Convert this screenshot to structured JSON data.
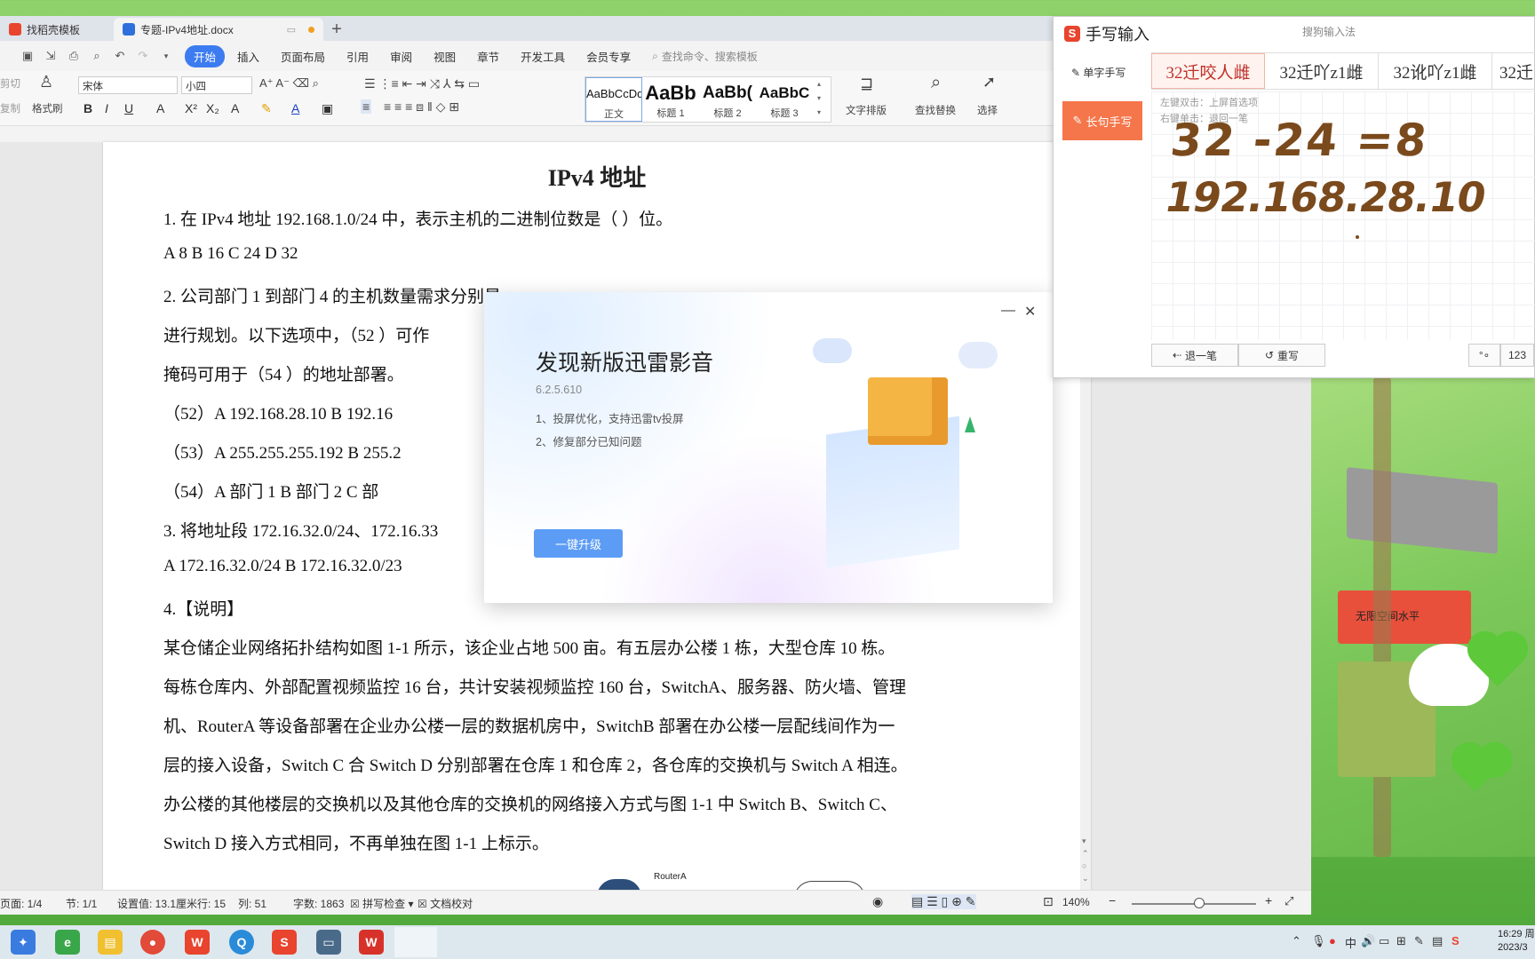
{
  "tabs": [
    {
      "label": "找稻壳模板",
      "icon": "wps-logo-icon"
    },
    {
      "label": "专题-IPv4地址.docx",
      "icon": "word-doc-icon"
    }
  ],
  "menu": [
    "开始",
    "插入",
    "页面布局",
    "引用",
    "审阅",
    "视图",
    "章节",
    "开发工具",
    "会员专享"
  ],
  "search_placeholder": "查找命令、搜索模板",
  "ribbon": {
    "cut": "剪切",
    "copy": "复制",
    "format_painter": "格式刷",
    "font_name": "宋体",
    "font_size": "小四",
    "styles": [
      {
        "sample": "AaBbCcDd",
        "label": "正文"
      },
      {
        "sample": "AaBb",
        "label": "标题 1"
      },
      {
        "sample": "AaBb(",
        "label": "标题 2"
      },
      {
        "sample": "AaBbC",
        "label": "标题 3"
      }
    ],
    "text_layout": "文字排版",
    "find_replace": "查找替换",
    "select": "选择"
  },
  "document": {
    "title": "IPv4 地址",
    "lines": [
      "1.  在 IPv4 地址 192.168.1.0/24 中，表示主机的二进制位数是（  ）位。",
      "A    8     B    16   C    24   D    32",
      "2.  公司部门 1 到部门 4 的主机数量需求分别是",
      "进行规划。以下选项中，（52  ）可作",
      "掩码可用于（54  ）的地址部署。",
      "（52）A    192.168.28.10      B    192.16",
      "（53）A    255.255.255.192   B    255.2",
      "（54）A    部门 1     B    部门 2   C    部",
      "3.  将地址段 172.16.32.0/24、172.16.33",
      "A    172.16.32.0/24    B    172.16.32.0/23",
      "4.【说明】",
      "某仓储企业网络拓扑结构如图 1-1 所示，该企业占地 500 亩。有五层办公楼 1 栋，大型仓库 10 栋。",
      "每栋仓库内、外部配置视频监控 16 台，共计安装视频监控 160 台，SwitchA、服务器、防火墙、管理",
      "机、RouterA 等设备部署在企业办公楼一层的数据机房中，SwitchB 部署在办公楼一层配线间作为一",
      "层的接入设备，Switch C 合 Switch D 分别部署在仓库 1 和仓库 2，各仓库的交换机与 Switch A 相连。",
      "办公楼的其他楼层的交换机以及其他仓库的交换机的网络接入方式与图 1-1 中 Switch B、Switch C、",
      "Switch D 接入方式相同，不再单独在图 1-1 上标示。"
    ],
    "figure_label": "RouterA"
  },
  "status": {
    "page": "页面: 1/4",
    "section": "节: 1/1",
    "setting": "设置值: 13.1厘米",
    "row": "行: 15",
    "col": "列: 51",
    "words": "字数: 1863",
    "spell": "拼写检查",
    "proof": "文档校对",
    "zoom": "140%"
  },
  "popup": {
    "title": "发现新版迅雷影音",
    "version": "6.2.5.610",
    "notes": [
      "1、投屏优化，支持迅雷tv投屏",
      "2、修复部分已知问题"
    ],
    "button": "一键升级"
  },
  "ime": {
    "title": "手写输入",
    "subtitle": "搜狗输入法",
    "single": "单字手写",
    "long": "长句手写",
    "candidates": [
      "32迁咬人雌",
      "32迁吖z1雌",
      "32讹吖z1雌",
      "32迁"
    ],
    "hint1": "左键双击：上屏首选项",
    "hint2": "右键单击：退回一笔",
    "handwriting_line1": "32 -24 =8",
    "handwriting_line2": "192.168.28.10",
    "undo": "退一笔",
    "rewrite": "重写",
    "numbers": "123"
  },
  "desktop": {
    "sign_text": "无限空间水平"
  },
  "clock": {
    "time": "16:29 周",
    "date": "2023/3"
  },
  "tray_ime": "中"
}
